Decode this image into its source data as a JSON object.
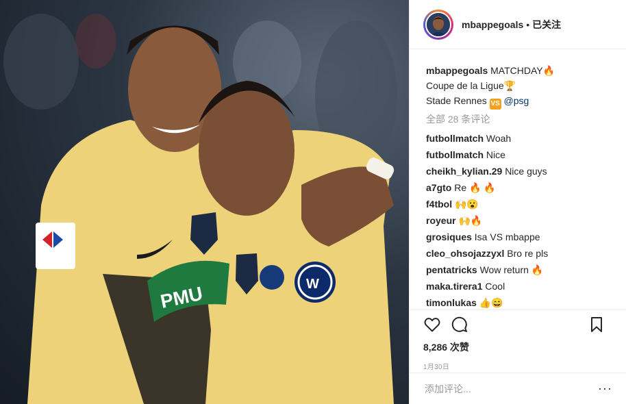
{
  "post": {
    "username": "mbappegoals",
    "dot": "•",
    "follow_status": "已关注",
    "caption": {
      "username": "mbappegoals",
      "line1": "MATCHDAY🔥",
      "line2": "Coupe de la Ligue🏆",
      "line3_text": "Stade Rennes",
      "vs_badge": "VS",
      "mention": "@psg"
    },
    "view_all_comments": "全部 28 条评论",
    "comments": [
      {
        "user": "futbollmatch",
        "text": "Woah"
      },
      {
        "user": "futbollmatch",
        "text": "Nice"
      },
      {
        "user": "cheikh_kylian.29",
        "text": "Nice guys"
      },
      {
        "user": "a7gto",
        "text": "Re 🔥 🔥"
      },
      {
        "user": "f4tbol",
        "text": "🙌😮"
      },
      {
        "user": "royeur",
        "text": "🙌🔥"
      },
      {
        "user": "grosiques",
        "text": "Isa VS mbappe"
      },
      {
        "user": "cleo_ohsojazzyxl",
        "text": "Bro re pls"
      },
      {
        "user": "pentatricks",
        "text": "Wow return 🔥"
      },
      {
        "user": "maka.tirera1",
        "text": "Cool"
      },
      {
        "user": "timonlukas",
        "text": "👍😄"
      }
    ],
    "likes": "8,286 次赞",
    "time": "1月30日",
    "add_comment_placeholder": "添加评论...",
    "more_label": "···"
  },
  "icons": {
    "like": "heart-icon",
    "comment": "comment-icon",
    "save": "bookmark-icon",
    "more": "more-options-icon"
  },
  "colors": {
    "jersey": "#eed27a",
    "accent_link": "#003569",
    "vs_badge": "#f4a21d",
    "muted": "#999999"
  }
}
